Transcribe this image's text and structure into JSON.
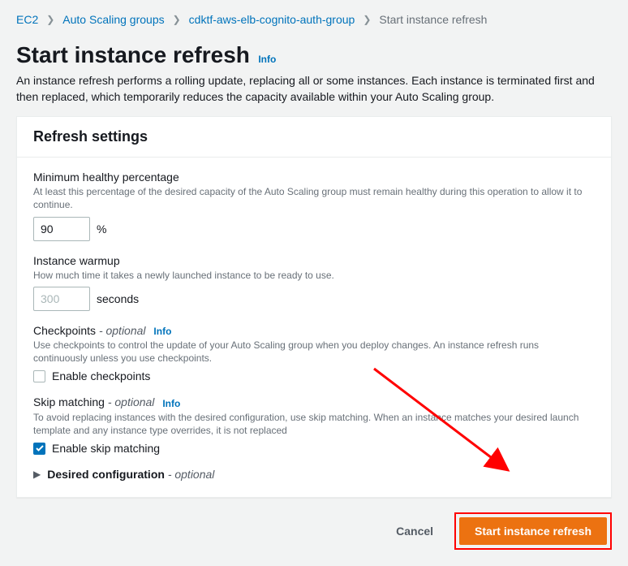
{
  "breadcrumbs": {
    "items": [
      "EC2",
      "Auto Scaling groups",
      "cdktf-aws-elb-cognito-auth-group"
    ],
    "current": "Start instance refresh"
  },
  "page": {
    "title": "Start instance refresh",
    "info": "Info",
    "description": "An instance refresh performs a rolling update, replacing all or some instances. Each instance is terminated first and then replaced, which temporarily reduces the capacity available within your Auto Scaling group."
  },
  "panel": {
    "title": "Refresh settings",
    "min_healthy": {
      "label": "Minimum healthy percentage",
      "help": "At least this percentage of the desired capacity of the Auto Scaling group must remain healthy during this operation to allow it to continue.",
      "value": "90",
      "unit": "%"
    },
    "warmup": {
      "label": "Instance warmup",
      "help": "How much time it takes a newly launched instance to be ready to use.",
      "placeholder": "300",
      "unit": "seconds"
    },
    "checkpoints": {
      "label": "Checkpoints",
      "optional": "- optional",
      "info": "Info",
      "help": "Use checkpoints to control the update of your Auto Scaling group when you deploy changes. An instance refresh runs continuously unless you use checkpoints.",
      "checkbox_label": "Enable checkpoints",
      "checked": false
    },
    "skip_matching": {
      "label": "Skip matching",
      "optional": "- optional",
      "info": "Info",
      "help": "To avoid replacing instances with the desired configuration, use skip matching. When an instance matches your desired launch template and any instance type overrides, it is not replaced",
      "checkbox_label": "Enable skip matching",
      "checked": true
    },
    "desired_config": {
      "label": "Desired configuration",
      "optional": "- optional"
    }
  },
  "actions": {
    "cancel": "Cancel",
    "submit": "Start instance refresh"
  }
}
